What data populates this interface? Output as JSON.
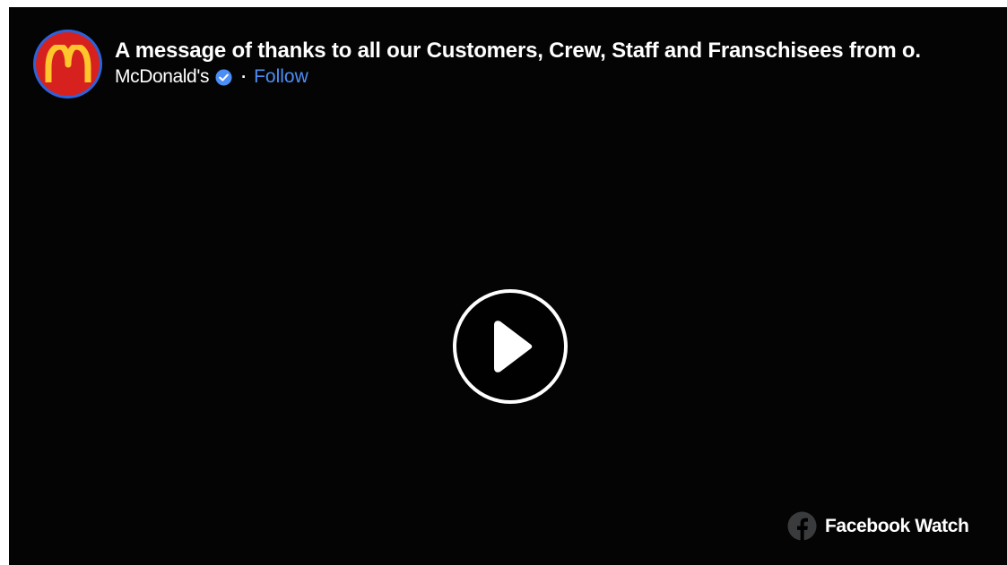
{
  "video": {
    "title": "A message of thanks to all our Customers, Crew, Staff and Franschisees from o.",
    "page_name": "McDonald's",
    "separator": "·",
    "follow_label": "Follow"
  },
  "watermark": {
    "label": "Facebook Watch"
  },
  "icons": {
    "avatar": "mcdonalds-logo",
    "verified": "verified-badge-icon",
    "play": "play-icon",
    "facebook": "facebook-icon"
  },
  "colors": {
    "background": "#040404",
    "avatar_ring": "#2d62d8",
    "avatar_fill": "#d7211e",
    "logo_arches": "#ffc72c",
    "follow_link": "#4c8ef5",
    "verified_badge": "#4c8ef5"
  }
}
